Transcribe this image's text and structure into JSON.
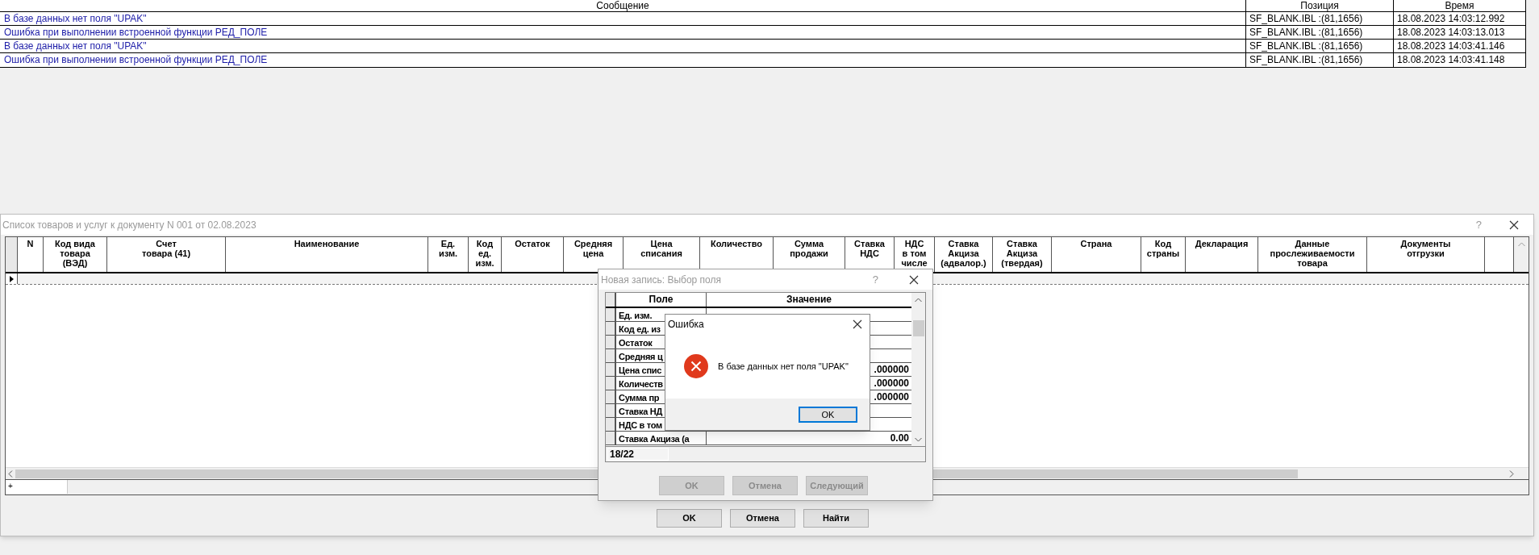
{
  "log": {
    "columns": [
      "Сообщение",
      "Позиция",
      "Время"
    ],
    "rows": [
      {
        "message": "В базе данных нет поля \"UPAK\"",
        "position": "SF_BLANK.IBL :(81,1656)",
        "time": "18.08.2023 14:03:12.992"
      },
      {
        "message": "Ошибка при выполнении встроенной функции РЕД_ПОЛЕ",
        "position": "SF_BLANK.IBL :(81,1656)",
        "time": "18.08.2023 14:03:13.013"
      },
      {
        "message": "В базе данных нет поля \"UPAK\"",
        "position": "SF_BLANK.IBL :(81,1656)",
        "time": "18.08.2023 14:03:41.146"
      },
      {
        "message": "Ошибка при выполнении встроенной функции РЕД_ПОЛЕ",
        "position": "SF_BLANK.IBL :(81,1656)",
        "time": "18.08.2023 14:03:41.148"
      }
    ]
  },
  "main_window": {
    "title": "Список товаров и услуг к документу N 001 от 02.08.2023",
    "help": "?",
    "columns": [
      "N",
      "Код вида\nтовара\n(ВЭД)",
      "Счет\nтовара (41)",
      "Наименование",
      "Ед.\nизм.",
      "Код\nед.\nизм.",
      "Остаток",
      "Средняя\nцена",
      "Цена\nсписания",
      "Количество",
      "Сумма\nпродажи",
      "Ставка\nНДС",
      "НДС\nв том\nчисле",
      "Ставка\nАкциза\n(адвалор.)",
      "Ставка\nАкциза\n(твердая)",
      "Страна",
      "Код\nстраны",
      "Декларация",
      "Данные\nпрослеживаемости\nтовара",
      "Документы\nотгрузки"
    ],
    "rows": [
      {
        "selected": true
      }
    ],
    "sheet_tab": "+",
    "buttons": [
      "OK",
      "Отмена",
      "Найти"
    ]
  },
  "field_dialog": {
    "title": "Новая запись: Выбор поля",
    "help": "?",
    "columns": [
      "Поле",
      "Значение"
    ],
    "rows": [
      {
        "field": "Ед. изм."
      },
      {
        "field": "Код ед. из"
      },
      {
        "field": "Остаток"
      },
      {
        "field": "Средняя ц"
      },
      {
        "field": "Цена спис",
        "value": ".000000"
      },
      {
        "field": "Количеств",
        "value": ".000000"
      },
      {
        "field": "Сумма пр",
        "value": ".000000"
      },
      {
        "field": "Ставка НД"
      },
      {
        "field": "НДС в том"
      },
      {
        "field": "Ставка Акциза (а",
        "value": "0.00"
      }
    ],
    "counter": "18/22",
    "buttons": [
      {
        "label": "OK",
        "disabled": true
      },
      {
        "label": "Отмена",
        "disabled": true
      },
      {
        "label": "Следующий",
        "disabled": true
      }
    ]
  },
  "error_dialog": {
    "title": "Ошибка",
    "message": "В базе данных нет поля \"UPAK\"",
    "button": "OK"
  }
}
